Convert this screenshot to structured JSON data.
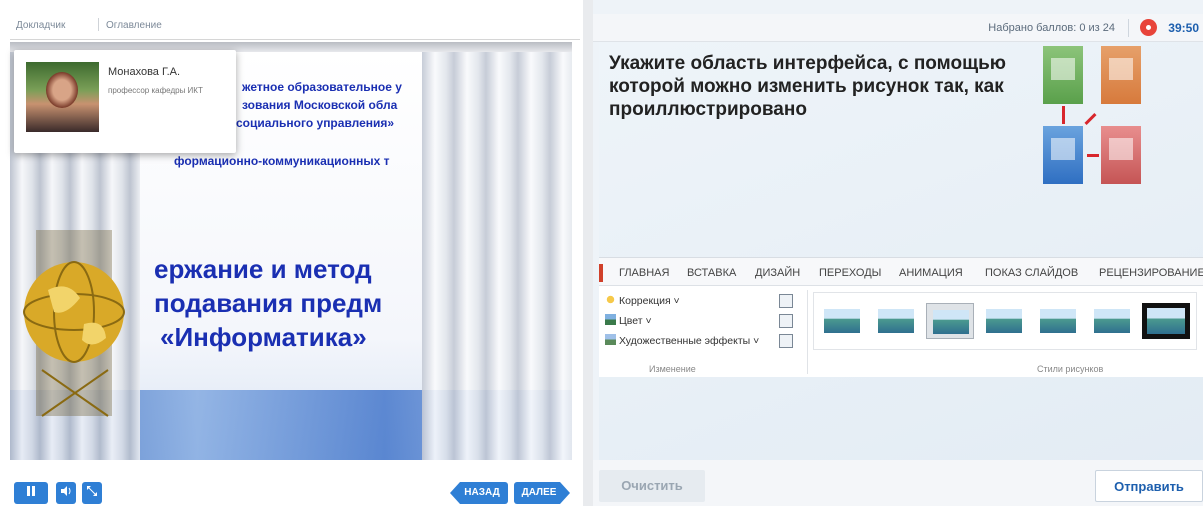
{
  "player": {
    "tabs": {
      "presenter": "Докладчик",
      "contents": "Оглавление"
    },
    "presenter": {
      "name": "Монахова Г.А.",
      "role": "профессор кафедры ИКТ"
    },
    "slide": {
      "header_lines": [
        "жетное образовательное у",
        "зования Московской обла",
        "социального управления»",
        "формационно-коммуникационных т"
      ],
      "title_lines": [
        "ержание и метод",
        "подавания предм",
        "«Информатика»"
      ]
    },
    "controls": {
      "pause_icon": "pause-icon",
      "volume_icon": "volume-icon",
      "fullscreen_icon": "fullscreen-icon",
      "back_label": "НАЗАД",
      "next_label": "ДАЛЕЕ"
    }
  },
  "quiz": {
    "score_text": "Набрано баллов: 0 из 24",
    "timer": "39:50",
    "question": "Укажите область интерфейса, с помощью которой можно изменить рисунок так, как проиллюстрировано",
    "ribbon": {
      "tabs": [
        "ГЛАВНАЯ",
        "ВСТАВКА",
        "ДИЗАЙН",
        "ПЕРЕХОДЫ",
        "АНИМАЦИЯ",
        "ПОКАЗ СЛАЙДОВ",
        "РЕЦЕНЗИРОВАНИЕ"
      ],
      "commands": [
        "Коррекция ˅",
        "Цвет ˅",
        "Художественные эффекты ˅"
      ],
      "group_change": "Изменение",
      "group_styles": "Стили рисунков"
    },
    "clear_label": "Очистить",
    "submit_label": "Отправить"
  },
  "colors": {
    "accent": "#2f7fd5",
    "timer": "#1d5fae",
    "timer_dot": "#e8443a",
    "ribbon_mark": "#d0402a"
  }
}
